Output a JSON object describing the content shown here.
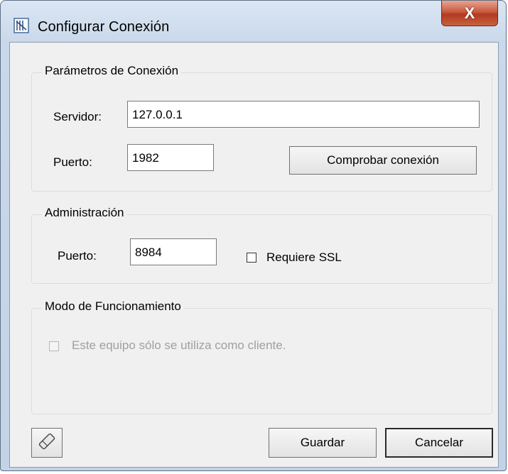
{
  "window": {
    "title": "Configurar Conexión",
    "close_label": "X"
  },
  "connection": {
    "group_label": "Parámetros de Conexión",
    "server_label": "Servidor:",
    "server_value": "127.0.0.1",
    "port_label": "Puerto:",
    "port_value": "1982",
    "check_button": "Comprobar conexión"
  },
  "admin": {
    "group_label": "Administración",
    "port_label": "Puerto:",
    "port_value": "8984",
    "ssl_label": "Requiere SSL",
    "ssl_checked": false
  },
  "mode": {
    "group_label": "Modo de Funcionamiento",
    "client_only_label": "Este equipo sólo se utiliza como cliente.",
    "client_only_checked": false,
    "client_only_enabled": false
  },
  "footer": {
    "save_button": "Guardar",
    "cancel_button": "Cancelar",
    "tool_icon": "eraser-icon"
  }
}
